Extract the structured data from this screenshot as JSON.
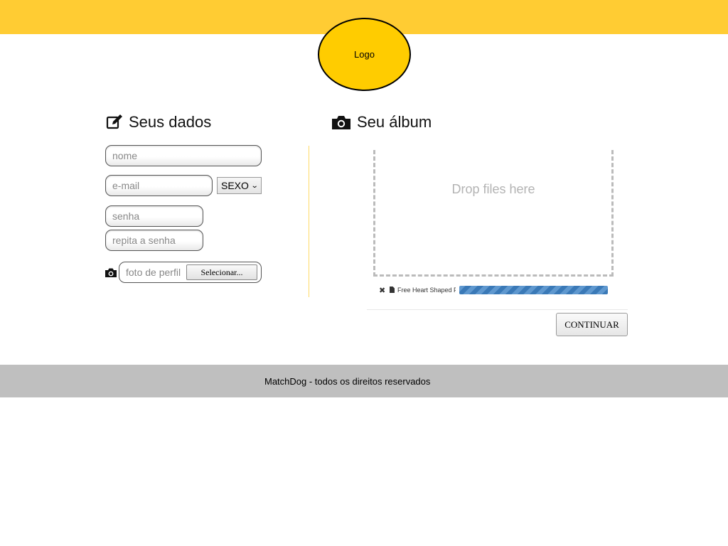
{
  "header": {
    "logo_text": "Logo"
  },
  "colors": {
    "brand_yellow": "#ffcc33",
    "logo_fill": "#ffcc00",
    "footer_gray": "#bfbfbf",
    "progress_blue": "#3a79b7"
  },
  "left": {
    "title": "Seus dados",
    "icon": "edit-icon",
    "nome_placeholder": "nome",
    "email_placeholder": "e-mail",
    "sexo_selected": "SEXO",
    "senha_placeholder": "senha",
    "repita_placeholder": "repita a senha",
    "foto_placeholder": "foto de perfil",
    "foto_button": "Selecionar...",
    "foto_icon": "camera-icon"
  },
  "right": {
    "title": "Seu álbum",
    "icon": "camera-icon",
    "dropzone_text": "Drop files here",
    "upload": {
      "file_name": "Free Heart Shaped P",
      "progress": 1.0
    },
    "continue_label": "CONTINUAR"
  },
  "footer": {
    "text": "MatchDog - todos os direitos reservados"
  }
}
